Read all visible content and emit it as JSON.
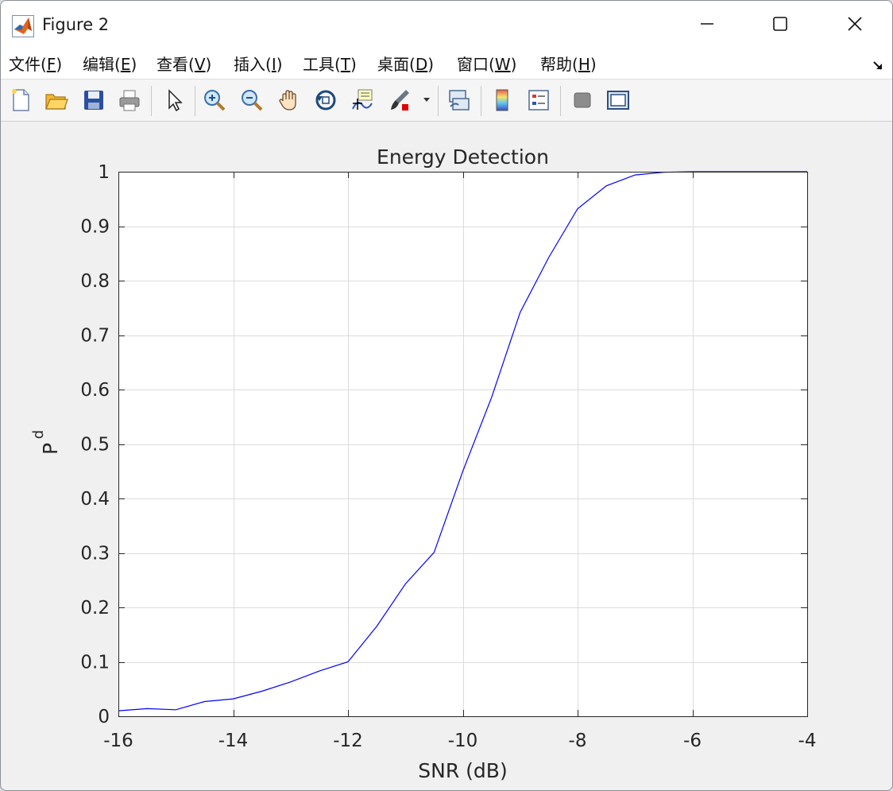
{
  "window": {
    "title": "Figure 2"
  },
  "menu": {
    "items": [
      {
        "pre": "文件(",
        "key": "F",
        "post": ")"
      },
      {
        "pre": "编辑(",
        "key": "E",
        "post": ")"
      },
      {
        "pre": "查看(",
        "key": "V",
        "post": ")"
      },
      {
        "pre": "插入(",
        "key": "I",
        "post": ")"
      },
      {
        "pre": "工具(",
        "key": "T",
        "post": ")"
      },
      {
        "pre": "桌面(",
        "key": "D",
        "post": ")"
      },
      {
        "pre": "窗口(",
        "key": "W",
        "post": ")"
      },
      {
        "pre": "帮助(",
        "key": "H",
        "post": ")"
      }
    ]
  },
  "toolbar": {
    "icons": [
      "new-figure-icon",
      "open-file-icon",
      "save-icon",
      "print-icon",
      "pointer-icon",
      "zoom-in-icon",
      "zoom-out-icon",
      "pan-icon",
      "rotate-3d-icon",
      "data-cursor-icon",
      "brush-icon",
      "link-plot-icon",
      "colorbar-icon",
      "legend-icon",
      "hide-plot-tools-icon",
      "show-plot-tools-icon"
    ]
  },
  "chart_data": {
    "type": "line",
    "title": "Energy Detection",
    "xlabel": "SNR (dB)",
    "ylabel_main": "P",
    "ylabel_sub": "d",
    "xlim": [
      -16,
      -4
    ],
    "ylim": [
      0,
      1
    ],
    "xticks": [
      -16,
      -14,
      -12,
      -10,
      -8,
      -6,
      -4
    ],
    "yticks": [
      0,
      0.1,
      0.2,
      0.3,
      0.4,
      0.5,
      0.6,
      0.7,
      0.8,
      0.9,
      1
    ],
    "grid": true,
    "series": [
      {
        "color": "#0000ff",
        "x": [
          -16,
          -15.5,
          -15,
          -14.5,
          -14,
          -13.5,
          -13,
          -12.5,
          -12,
          -11.5,
          -11,
          -10.5,
          -10,
          -9.5,
          -9,
          -8.5,
          -8,
          -7.5,
          -7,
          -6.5,
          -6,
          -5.5,
          -5,
          -4.5,
          -4
        ],
        "y": [
          0.01,
          0.014,
          0.012,
          0.027,
          0.032,
          0.046,
          0.063,
          0.083,
          0.1,
          0.165,
          0.243,
          0.301,
          0.45,
          0.585,
          0.742,
          0.843,
          0.932,
          0.974,
          0.994,
          0.999,
          1.0,
          1.0,
          1.0,
          1.0,
          1.0
        ]
      }
    ]
  }
}
